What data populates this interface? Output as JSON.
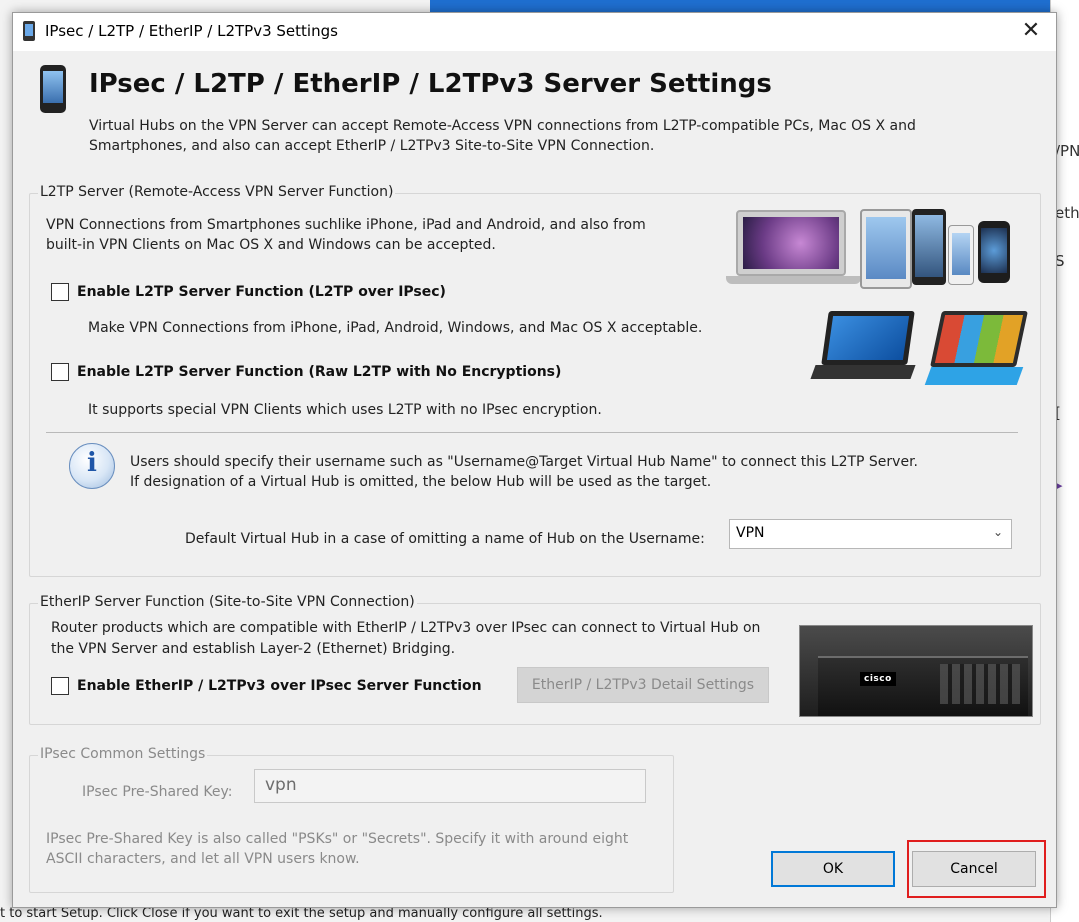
{
  "background": {
    "bottom_text": "t to start Setup. Click Close if you want to exit the setup and manually configure all settings.",
    "right_fragments": [
      "/PN",
      "eth",
      "S",
      "[",
      "▸"
    ]
  },
  "dialog": {
    "window_title": "IPsec / L2TP / EtherIP / L2TPv3 Settings",
    "close_glyph": "✕",
    "header": {
      "title": "IPsec / L2TP / EtherIP / L2TPv3 Server Settings",
      "desc_line1": "Virtual Hubs on the VPN Server can accept Remote-Access VPN connections from L2TP-compatible PCs, Mac OS X and",
      "desc_line2": "Smartphones, and also can accept EtherIP / L2TPv3 Site-to-Site VPN Connection."
    },
    "l2tp": {
      "legend": "L2TP Server (Remote-Access VPN Server Function)",
      "desc_line1": "VPN Connections from Smartphones suchlike iPhone, iPad and Android, and also from",
      "desc_line2": "built-in VPN Clients on Mac OS X and Windows can be accepted.",
      "enable_ipsec_label": "Enable L2TP Server Function (L2TP over IPsec)",
      "enable_ipsec_checked": false,
      "enable_ipsec_desc": "Make VPN Connections from iPhone, iPad, Android, Windows, and Mac OS X acceptable.",
      "enable_raw_label": "Enable L2TP Server Function (Raw L2TP with No Encryptions)",
      "enable_raw_checked": false,
      "enable_raw_desc": "It supports special VPN Clients which uses L2TP with no IPsec encryption.",
      "info_line1": "Users should specify their username such as \"Username@Target Virtual Hub Name\" to connect this L2TP Server.",
      "info_line2": "If designation of a Virtual Hub is omitted, the below Hub will be used as the target.",
      "default_hub_label": "Default Virtual Hub in a case of omitting a name of Hub on the Username:",
      "default_hub_value": "VPN"
    },
    "etherip": {
      "legend": "EtherIP Server Function (Site-to-Site VPN Connection)",
      "desc_line1": "Router products which are compatible with EtherIP / L2TPv3 over IPsec can connect to Virtual Hub on",
      "desc_line2": "the VPN Server and establish Layer-2 (Ethernet) Bridging.",
      "enable_label": "Enable EtherIP / L2TPv3 over IPsec Server Function",
      "enable_checked": false,
      "detail_button": "EtherIP / L2TPv3 Detail Settings",
      "router_logo": "cisco"
    },
    "ipsec": {
      "legend": "IPsec Common Settings",
      "psk_label": "IPsec Pre-Shared Key:",
      "psk_value": "vpn",
      "note_line1": "IPsec Pre-Shared Key is also called \"PSKs\" or \"Secrets\". Specify it with around eight",
      "note_line2": "ASCII characters, and let all VPN users know."
    },
    "buttons": {
      "ok": "OK",
      "cancel": "Cancel"
    },
    "colors": {
      "highlight": "#e01e1e",
      "default_button_border": "#0078d7"
    }
  }
}
